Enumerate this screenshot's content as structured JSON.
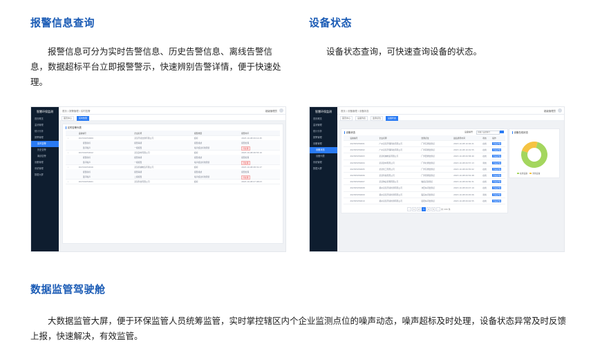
{
  "sections": {
    "alarm": {
      "title": "报警信息查询",
      "body": "报警信息可分为实时告警信息、历史告警信息、离线告警信息，数据超标平台立即报警警示，快速辨别告警详情，便于快速处理。"
    },
    "device": {
      "title": "设备状态",
      "body": "设备状态查询，可快速查询设备的状态。"
    },
    "cockpit": {
      "title": "数据监管驾驶舱",
      "body": "大数据监管大屏，便于环保监管人员统筹监管，实时掌控辖区内个企业监测点位的噪声动态，噪声超标及时处理，设备状态异常及时反馈上报，快速解决，有效监管。"
    }
  },
  "screenshots": {
    "alarm": {
      "brand": "智慧环保监测",
      "menu": [
        "首页概览",
        "监测管理",
        "统计分析",
        "报警管理",
        "实时告警",
        "历史告警",
        "离线告警",
        "设备管理",
        "系统管理",
        "数据大屏"
      ],
      "active_menu_index": 4,
      "breadcrumb": "首页 / 报警管理 / 实时告警",
      "user": "超级管理员",
      "tabs": [
        "首页中心",
        "实时告警"
      ],
      "active_tab_index": 1,
      "card_title": "实时告警列表",
      "columns": [
        "设备编号",
        "企业名称",
        "报警类型",
        "报警时间"
      ],
      "sub_columns": [
        "报警指标",
        "报警等级",
        "报警描述",
        "报警处理"
      ],
      "rows": [
        {
          "main": [
            "202301050009",
            "某某环境监测有限公司",
            "超标",
            "2023-10-08 09:12:45"
          ],
          "sub": [
            "昼间噪声",
            "一级报警",
            "噪声超过标准限值",
            "待处理"
          ]
        },
        {
          "main": [
            "202301050012",
            "某某建材有限公司",
            "超标",
            "2023-10-08 08:55:10"
          ],
          "sub": [
            "昼间噪声",
            "一级报警",
            "噪声超过标准限值",
            "待处理"
          ]
        },
        {
          "main": [
            "202301050016",
            "某某机械制造有限公司",
            "超标",
            "2023-10-08 08:31:27"
          ],
          "sub": [
            "夜间噪声",
            "二级报警",
            "噪声超过标准限值",
            "待处理"
          ]
        },
        {
          "main": [
            "202301050021",
            "某某科技有限公司",
            "超标",
            "2023-10-08 07:48:03"
          ],
          "sub": []
        }
      ]
    },
    "device": {
      "brand": "智慧环保监测",
      "menu": [
        "首页概览",
        "监测管理",
        "统计分析",
        "报警管理",
        "设备管理",
        "设备状态",
        "设备列表",
        "系统管理",
        "数据大屏"
      ],
      "active_menu_index": 5,
      "breadcrumb": "首页 / 设备管理 / 设备状态",
      "user": "超级管理员",
      "tabs": [
        "首页中心",
        "设备列表",
        "监测点位",
        "设备状态"
      ],
      "active_tab_index": 3,
      "card_title": "设备状态",
      "search_label": "设备编号",
      "search_placeholder": "请输入设备编号",
      "columns": [
        "设备编号",
        "企业名称",
        "监测点位",
        "最后通讯时间",
        "状态",
        "操作"
      ],
      "rows": [
        [
          "202305050001",
          "广州某某环保科技有限公司",
          "厂界东侧监测点",
          "2023-10-08 10:02:21",
          "在线",
          "查看详情"
        ],
        [
          "202305050002",
          "广州某某环保科技有限公司",
          "厂界南侧监测点",
          "2023-10-08 10:01:55",
          "在线",
          "查看详情"
        ],
        [
          "202305050003",
          "某某机械制造有限公司",
          "厂界西侧监测点",
          "2023-10-08 09:58:40",
          "在线",
          "查看详情"
        ],
        [
          "202305050004",
          "某某建材有限公司",
          "厂界北侧监测点",
          "2023-10-08 09:57:13",
          "离线",
          "查看详情"
        ],
        [
          "202305050005",
          "某某化工有限公司",
          "厂界东侧监测点",
          "2023-10-08 09:55:02",
          "在线",
          "查看详情"
        ],
        [
          "202305050006",
          "某某科技有限公司",
          "厂界南侧监测点",
          "2023-10-08 09:52:48",
          "在线",
          "查看详情"
        ],
        [
          "202305050007",
          "某某物业管理有限公司",
          "敏感点监测点",
          "2023-10-08 09:50:31",
          "在线",
          "查看详情"
        ],
        [
          "202305050008",
          "郑州某某环境检测有限公司",
          "冲压车间监测点",
          "2023-10-08 09:47:19",
          "在线",
          "查看详情"
        ],
        [
          "202305050009",
          "郑州某某环境检测有限公司",
          "锻造车间监测点",
          "2023-10-08 09:45:06",
          "离线",
          "查看详情"
        ],
        [
          "202305050010",
          "郑州某某环境检测有限公司",
          "装配车间监测点",
          "2023-10-08 09:42:55",
          "在线",
          "查看详情"
        ]
      ],
      "pager": {
        "pages": [
          "1",
          "2",
          "3",
          "4",
          "5"
        ],
        "active_index": 2,
        "total": "共 100 条"
      },
      "chart_data": {
        "type": "pie",
        "title": "设备在线状态",
        "categories": [
          "在线设备",
          "离线设备"
        ],
        "values": [
          76,
          24
        ],
        "colors": [
          "#a4d65e",
          "#f5c342"
        ]
      }
    }
  }
}
